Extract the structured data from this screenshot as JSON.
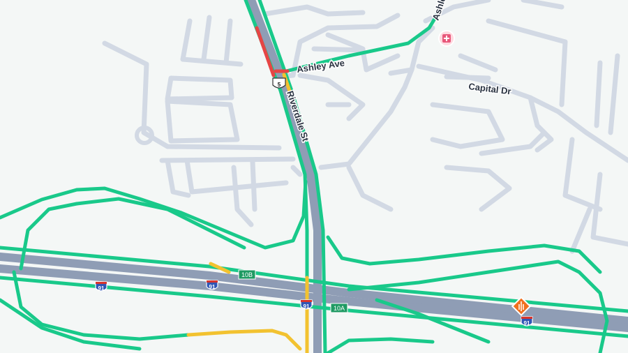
{
  "streets": {
    "ashley_ave": "Ashley Ave",
    "ashley_partial": "Ashle",
    "riverdale_st": "Riverdale St",
    "capital_dr": "Capital Dr"
  },
  "route_shields": {
    "us_5": "5",
    "i91_left": "91",
    "i91_middle": "91",
    "i91_center": "91",
    "i91_right": "91"
  },
  "exits": {
    "exit_10b": "10B",
    "exit_10a": "10A"
  },
  "icons": {
    "hospital": "hospital-icon",
    "incident": "traffic-incident-icon"
  },
  "colors": {
    "background": "#f4f7f6",
    "minor_road": "#d2d9e4",
    "highway_casing": "#8f9db5",
    "traffic_free": "#19c98a",
    "traffic_slow": "#f2c230",
    "traffic_heavy": "#e64545",
    "incident": "#f0701e",
    "exit_sign": "#1f9a63",
    "interstate_shield": "#2f56b5"
  }
}
